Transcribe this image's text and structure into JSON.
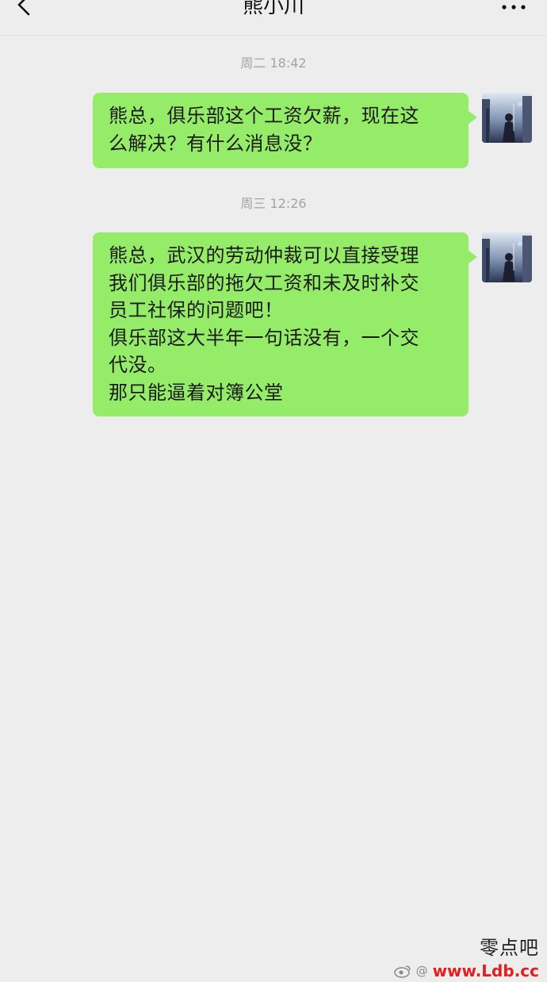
{
  "header": {
    "title": "熊小川",
    "back_icon": "chevron-left-icon",
    "more_icon": "more-dots-icon"
  },
  "messages": [
    {
      "timestamp": "周二 18:42",
      "lines": [
        "熊总，俱乐部这个工资欠薪，现在这",
        "么解决？有什么消息没？"
      ]
    },
    {
      "timestamp": "周三 12:26",
      "lines": [
        "熊总，武汉的劳动仲裁可以直接受理",
        "我们俱乐部的拖欠工资和未及时补交",
        "员工社保的问题吧！",
        "俱乐部这大半年一句话没有，一个交",
        "代没。",
        "那只能逼着对簿公堂"
      ]
    }
  ],
  "watermark": {
    "logo_text": "零点吧",
    "weibo_text": "@",
    "url": "www.Ldb.cc"
  },
  "colors": {
    "background": "#ededed",
    "bubble_green": "#95ec69",
    "timestamp_gray": "#a3a3a3",
    "watermark_red": "#e02020"
  }
}
